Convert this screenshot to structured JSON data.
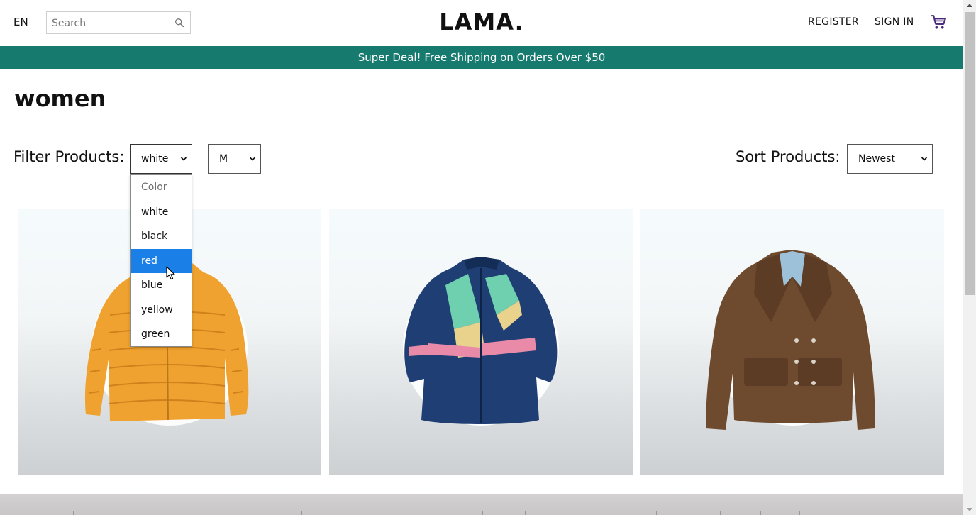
{
  "navbar": {
    "language": "EN",
    "search_placeholder": "Search",
    "logo": "LAMA.",
    "register_label": "REGISTER",
    "signin_label": "SIGN IN",
    "search_icon": "search-icon",
    "cart_icon": "cart-icon"
  },
  "announcement": "Super Deal! Free Shipping on Orders Over $50",
  "page": {
    "title": "women"
  },
  "filters": {
    "label": "Filter Products:",
    "color_value": "white",
    "size_value": "M",
    "color_options": [
      "Color",
      "white",
      "black",
      "red",
      "blue",
      "yellow",
      "green"
    ],
    "highlighted_option": "red"
  },
  "sort": {
    "label": "Sort Products:",
    "value": "Newest"
  },
  "colors": {
    "announcement_bg": "#177a6f",
    "highlight": "#1a80e8",
    "cart": "#4a2a7a"
  },
  "products": [
    {
      "name": "product-card-orange-puffer-jacket"
    },
    {
      "name": "product-card-retro-windbreaker"
    },
    {
      "name": "product-card-brown-jacket"
    }
  ]
}
